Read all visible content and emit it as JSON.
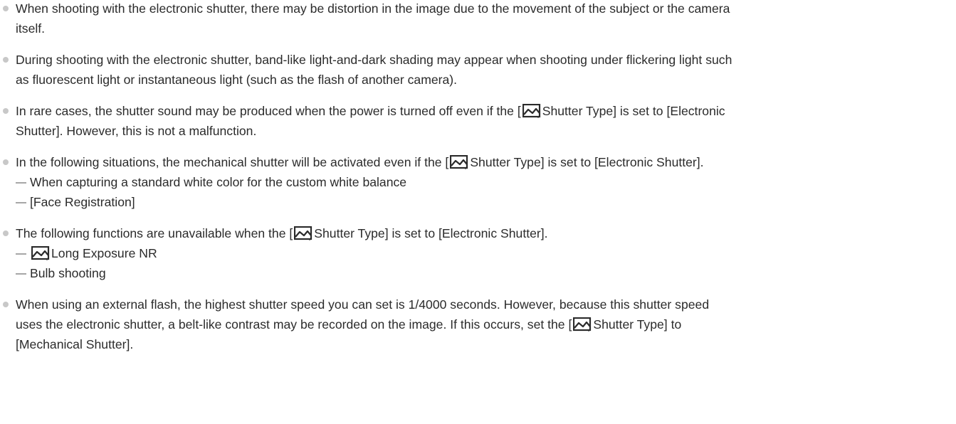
{
  "icons": {
    "still-camera": "still-image-mode-icon"
  },
  "notes": [
    {
      "lines": [
        [
          "When shooting with the electronic shutter, there may be distortion in the image due to the movement of the subject or the camera"
        ],
        [
          "itself."
        ]
      ]
    },
    {
      "lines": [
        [
          "During shooting with the electronic shutter, band-like light-and-dark shading may appear when shooting under flickering light such"
        ],
        [
          "as fluorescent light or instantaneous light (such as the flash of another camera)."
        ]
      ]
    },
    {
      "lines": [
        [
          "In rare cases, the shutter sound may be produced when the power is turned off even if the [",
          "Shutter Type] is set to [Electronic"
        ],
        [
          "Shutter]. However, this is not a malfunction."
        ]
      ]
    },
    {
      "lines": [
        [
          "In the following situations, the mechanical shutter will be activated even if the [",
          "Shutter Type] is set to [Electronic Shutter]."
        ]
      ],
      "sub": [
        [
          "When capturing a standard white color for the custom white balance"
        ],
        [
          "[Face Registration]"
        ]
      ]
    },
    {
      "lines": [
        [
          "The following functions are unavailable when the [",
          "Shutter Type] is set to [Electronic Shutter]."
        ]
      ],
      "sub": [
        [
          "",
          "Long Exposure NR"
        ],
        [
          "Bulb shooting"
        ]
      ]
    },
    {
      "lines": [
        [
          "When using an external flash, the highest shutter speed you can set is 1/4000 seconds. However, because this shutter speed"
        ],
        [
          "uses the electronic shutter, a belt-like contrast may be recorded on the image. If this occurs, set the [",
          "Shutter Type] to"
        ],
        [
          "[Mechanical Shutter]."
        ]
      ]
    }
  ]
}
